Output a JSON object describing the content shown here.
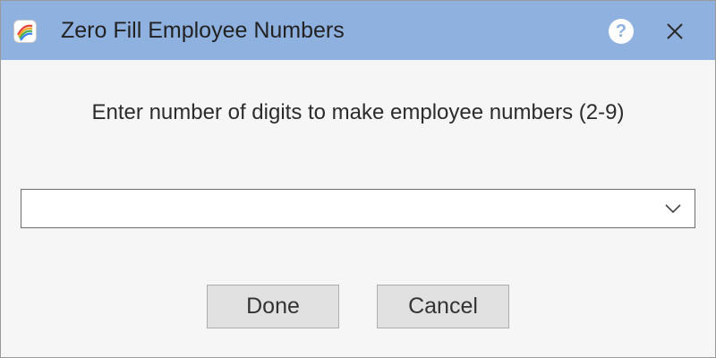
{
  "window": {
    "title": "Zero Fill Employee Numbers",
    "app_icon": "rainbow-app-icon",
    "help_icon": "question-icon",
    "help_glyph": "?",
    "close_icon": "close-icon",
    "titlebar_color": "#8fb1e0"
  },
  "content": {
    "prompt": "Enter number of digits to make employee numbers (2-9)",
    "digits_select": {
      "value": "",
      "icon": "chevron-down-icon"
    }
  },
  "buttons": {
    "done_label": "Done",
    "cancel_label": "Cancel"
  }
}
